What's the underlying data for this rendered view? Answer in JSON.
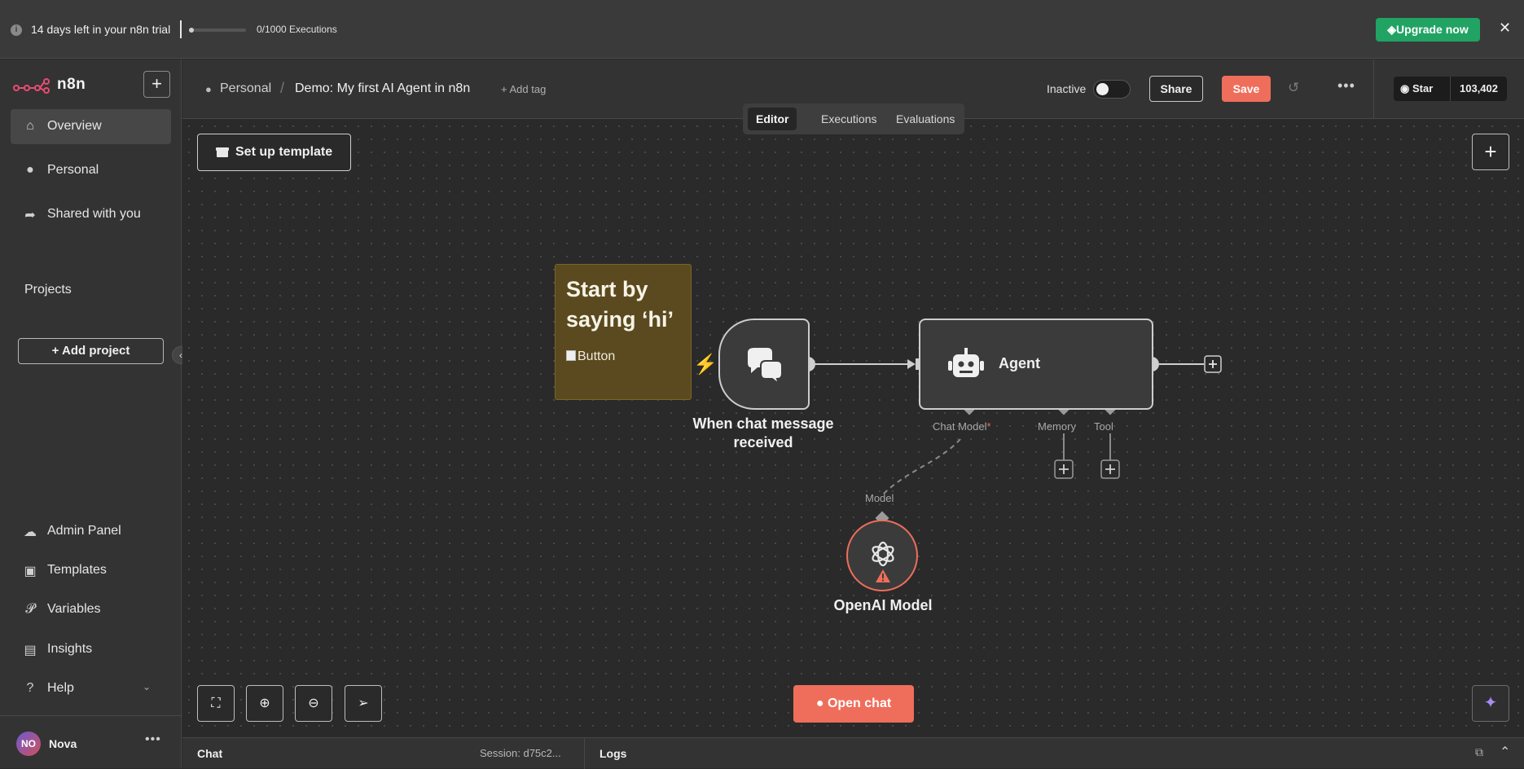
{
  "banner": {
    "trial_text": "14 days left in your n8n trial",
    "executions_text": "0/1000 Executions",
    "executions_used": 0,
    "executions_limit": 1000,
    "upgrade_label": "Upgrade now",
    "upgrade_color": "#21a363"
  },
  "sidebar": {
    "brand": "n8n",
    "nav": [
      {
        "label": "Overview",
        "icon": "home-icon",
        "active": true
      },
      {
        "label": "Personal",
        "icon": "user-icon"
      },
      {
        "label": "Shared with you",
        "icon": "share-icon"
      }
    ],
    "projects_title": "Projects",
    "add_project_label": "Add project",
    "bottom_nav": [
      {
        "label": "Admin Panel",
        "icon": "cloud-icon"
      },
      {
        "label": "Templates",
        "icon": "box-icon"
      },
      {
        "label": "Variables",
        "icon": "variable-icon"
      },
      {
        "label": "Insights",
        "icon": "chart-icon"
      },
      {
        "label": "Help",
        "icon": "help-icon"
      }
    ],
    "user": {
      "initials": "NO",
      "name": "Nova"
    }
  },
  "header": {
    "breadcrumb_project": "Personal",
    "workflow_name": "Demo: My first AI Agent in n8n",
    "add_tag_label": "+ Add tag",
    "status_label": "Inactive",
    "active": false,
    "share_label": "Share",
    "save_label": "Save",
    "save_color": "#ef6e5b",
    "github_star_label": "Star",
    "github_star_count": "103,402"
  },
  "tabs": [
    {
      "label": "Editor",
      "active": true
    },
    {
      "label": "Executions"
    },
    {
      "label": "Evaluations"
    }
  ],
  "canvas": {
    "setup_template_label": "Set up template",
    "sticky": {
      "title": "Start by saying ‘hi’",
      "image_alt": "Button"
    },
    "trigger_node": {
      "label": "When chat message received"
    },
    "agent_node": {
      "label": "Agent",
      "ports": {
        "chat_model": "Chat Model",
        "memory": "Memory",
        "tool": "Tool"
      },
      "required_marker": "*"
    },
    "model_port_label": "Model",
    "openai_node": {
      "label": "OpenAI Model"
    },
    "open_chat_label": "Open chat"
  },
  "bottombar": {
    "chat_label": "Chat",
    "session_text": "Session: d75c2...",
    "logs_label": "Logs"
  }
}
